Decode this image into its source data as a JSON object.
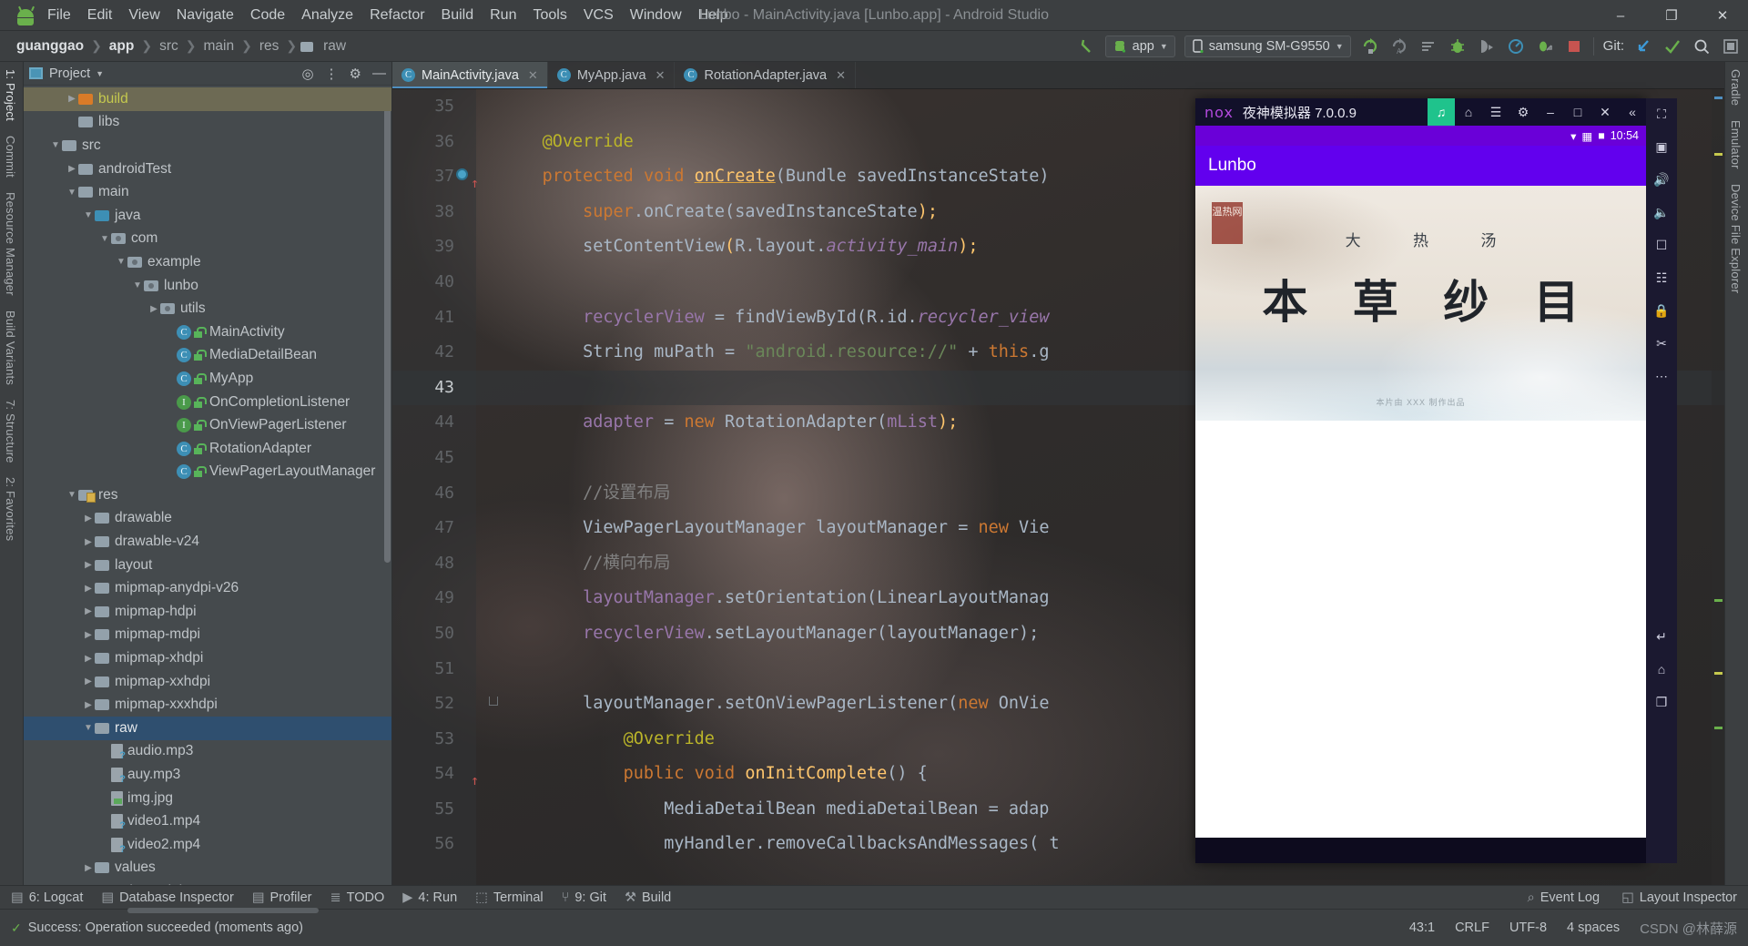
{
  "window": {
    "title": "Lunbo - MainActivity.java [Lunbo.app] - Android Studio",
    "minimize": "–",
    "maximize": "❐",
    "close": "✕"
  },
  "menu": [
    "File",
    "Edit",
    "View",
    "Navigate",
    "Code",
    "Analyze",
    "Refactor",
    "Build",
    "Run",
    "Tools",
    "VCS",
    "Window",
    "Help"
  ],
  "breadcrumb": [
    "guanggao",
    "app",
    "src",
    "main",
    "res",
    "raw"
  ],
  "toolbar": {
    "module_label": "app",
    "device_label": "samsung SM-G9550",
    "git_label": "Git:",
    "icons": [
      "back-arrow-icon",
      "rerun-icon",
      "rerun-failed-icon",
      "run-with-coverage-icon",
      "debug-icon",
      "attach-debugger-icon",
      "profiler-icon",
      "apply-changes-icon",
      "stop-icon",
      "git-update-icon",
      "git-commit-icon",
      "search-everywhere-icon",
      "settings-icon"
    ]
  },
  "project_panel": {
    "title": "Project",
    "tools": [
      "locate-icon",
      "collapse-all-icon",
      "settings-icon",
      "hide-icon"
    ],
    "tree": [
      {
        "depth": 2,
        "arrow": "▶",
        "label": "build",
        "icon": "folder-orange",
        "state": "hover"
      },
      {
        "depth": 2,
        "arrow": "",
        "label": "libs",
        "icon": "folder"
      },
      {
        "depth": 1,
        "arrow": "▼",
        "label": "src",
        "icon": "folder"
      },
      {
        "depth": 2,
        "arrow": "▶",
        "label": "androidTest",
        "icon": "folder"
      },
      {
        "depth": 2,
        "arrow": "▼",
        "label": "main",
        "icon": "folder"
      },
      {
        "depth": 3,
        "arrow": "▼",
        "label": "java",
        "icon": "folder-blue"
      },
      {
        "depth": 4,
        "arrow": "▼",
        "label": "com",
        "icon": "package"
      },
      {
        "depth": 5,
        "arrow": "▼",
        "label": "example",
        "icon": "package"
      },
      {
        "depth": 6,
        "arrow": "▼",
        "label": "lunbo",
        "icon": "package"
      },
      {
        "depth": 7,
        "arrow": "▶",
        "label": "utils",
        "icon": "package"
      },
      {
        "depth": 8,
        "arrow": "",
        "label": "MainActivity",
        "icon": "class"
      },
      {
        "depth": 8,
        "arrow": "",
        "label": "MediaDetailBean",
        "icon": "class"
      },
      {
        "depth": 8,
        "arrow": "",
        "label": "MyApp",
        "icon": "class"
      },
      {
        "depth": 8,
        "arrow": "",
        "label": "OnCompletionListener",
        "icon": "interface"
      },
      {
        "depth": 8,
        "arrow": "",
        "label": "OnViewPagerListener",
        "icon": "interface"
      },
      {
        "depth": 8,
        "arrow": "",
        "label": "RotationAdapter",
        "icon": "class"
      },
      {
        "depth": 8,
        "arrow": "",
        "label": "ViewPagerLayoutManager",
        "icon": "class"
      },
      {
        "depth": 2,
        "arrow": "▼",
        "label": "res",
        "icon": "folder-res"
      },
      {
        "depth": 3,
        "arrow": "▶",
        "label": "drawable",
        "icon": "folder"
      },
      {
        "depth": 3,
        "arrow": "▶",
        "label": "drawable-v24",
        "icon": "folder"
      },
      {
        "depth": 3,
        "arrow": "▶",
        "label": "layout",
        "icon": "folder"
      },
      {
        "depth": 3,
        "arrow": "▶",
        "label": "mipmap-anydpi-v26",
        "icon": "folder"
      },
      {
        "depth": 3,
        "arrow": "▶",
        "label": "mipmap-hdpi",
        "icon": "folder"
      },
      {
        "depth": 3,
        "arrow": "▶",
        "label": "mipmap-mdpi",
        "icon": "folder"
      },
      {
        "depth": 3,
        "arrow": "▶",
        "label": "mipmap-xhdpi",
        "icon": "folder"
      },
      {
        "depth": 3,
        "arrow": "▶",
        "label": "mipmap-xxhdpi",
        "icon": "folder"
      },
      {
        "depth": 3,
        "arrow": "▶",
        "label": "mipmap-xxxhdpi",
        "icon": "folder"
      },
      {
        "depth": 3,
        "arrow": "▼",
        "label": "raw",
        "icon": "folder",
        "state": "selected"
      },
      {
        "depth": 4,
        "arrow": "",
        "label": "audio.mp3",
        "icon": "file-unknown"
      },
      {
        "depth": 4,
        "arrow": "",
        "label": "auy.mp3",
        "icon": "file-unknown"
      },
      {
        "depth": 4,
        "arrow": "",
        "label": "img.jpg",
        "icon": "file-image"
      },
      {
        "depth": 4,
        "arrow": "",
        "label": "video1.mp4",
        "icon": "file-unknown"
      },
      {
        "depth": 4,
        "arrow": "",
        "label": "video2.mp4",
        "icon": "file-unknown"
      },
      {
        "depth": 3,
        "arrow": "▶",
        "label": "values",
        "icon": "folder"
      },
      {
        "depth": 3,
        "arrow": "▶",
        "label": "values-night",
        "icon": "folder"
      }
    ]
  },
  "left_rail": [
    "1: Project",
    "Commit",
    "Resource Manager",
    "Build Variants",
    "7: Structure",
    "2: Favorites"
  ],
  "right_rail": [
    "Gradle",
    "Emulator",
    "Device File Explorer"
  ],
  "editor": {
    "tabs": [
      {
        "label": "MainActivity.java",
        "active": true
      },
      {
        "label": "MyApp.java",
        "active": false
      },
      {
        "label": "RotationAdapter.java",
        "active": false
      }
    ],
    "first_line": 35,
    "caret_line": 43,
    "lines": [
      {
        "n": 35,
        "text": ""
      },
      {
        "n": 36,
        "text": "    @Override",
        "tokens": [
          {
            "t": "    ",
            "c": "plain"
          },
          {
            "t": "@Override",
            "c": "anno"
          }
        ]
      },
      {
        "n": 37,
        "marks": "breakpoint-override",
        "tokens": [
          {
            "t": "    ",
            "c": "plain"
          },
          {
            "t": "protected",
            "c": "kw"
          },
          {
            "t": " ",
            "c": "plain"
          },
          {
            "t": "void",
            "c": "kw"
          },
          {
            "t": " ",
            "c": "plain"
          },
          {
            "t": "onCreate",
            "c": "fn-u"
          },
          {
            "t": "(Bundle savedInstanceState)",
            "c": "plain"
          }
        ]
      },
      {
        "n": 38,
        "tokens": [
          {
            "t": "        ",
            "c": "plain"
          },
          {
            "t": "super",
            "c": "kw"
          },
          {
            "t": ".onCreate(savedInstanceState",
            "c": "plain"
          },
          {
            "t": ")",
            "c": "fn"
          },
          {
            "t": ";",
            "c": "fn"
          }
        ]
      },
      {
        "n": 39,
        "tokens": [
          {
            "t": "        setContentView",
            "c": "plain"
          },
          {
            "t": "(",
            "c": "fn"
          },
          {
            "t": "R.layout.",
            "c": "plain"
          },
          {
            "t": "activity_main",
            "c": "fld-i"
          },
          {
            "t": ")",
            "c": "fn"
          },
          {
            "t": ";",
            "c": "fn"
          }
        ]
      },
      {
        "n": 40,
        "text": ""
      },
      {
        "n": 41,
        "tokens": [
          {
            "t": "        ",
            "c": "plain"
          },
          {
            "t": "recyclerView",
            "c": "fld"
          },
          {
            "t": " = findViewById(",
            "c": "plain"
          },
          {
            "t": "R.id.",
            "c": "plain"
          },
          {
            "t": "recycler_view",
            "c": "fld-i"
          }
        ]
      },
      {
        "n": 42,
        "tokens": [
          {
            "t": "        String muPath = ",
            "c": "plain"
          },
          {
            "t": "\"android.resource://\"",
            "c": "str"
          },
          {
            "t": " + ",
            "c": "plain"
          },
          {
            "t": "this",
            "c": "kw"
          },
          {
            "t": ".g",
            "c": "plain"
          }
        ]
      },
      {
        "n": 43,
        "text": "",
        "caret": true
      },
      {
        "n": 44,
        "tokens": [
          {
            "t": "        ",
            "c": "plain"
          },
          {
            "t": "adapter",
            "c": "fld"
          },
          {
            "t": " = ",
            "c": "plain"
          },
          {
            "t": "new",
            "c": "kw"
          },
          {
            "t": " RotationAdapter(",
            "c": "plain"
          },
          {
            "t": "mList",
            "c": "fld"
          },
          {
            "t": ");",
            "c": "fn"
          }
        ]
      },
      {
        "n": 45,
        "text": ""
      },
      {
        "n": 46,
        "tokens": [
          {
            "t": "        //设置布局",
            "c": "cmt"
          }
        ]
      },
      {
        "n": 47,
        "tokens": [
          {
            "t": "        ViewPagerLayoutManager layoutManager = ",
            "c": "plain"
          },
          {
            "t": "new",
            "c": "kw"
          },
          {
            "t": " Vie",
            "c": "plain"
          }
        ]
      },
      {
        "n": 48,
        "tokens": [
          {
            "t": "        //横向布局",
            "c": "cmt"
          }
        ]
      },
      {
        "n": 49,
        "tokens": [
          {
            "t": "        ",
            "c": "plain"
          },
          {
            "t": "layoutManager",
            "c": "fld"
          },
          {
            "t": ".setOrientation(LinearLayoutManag",
            "c": "plain"
          }
        ]
      },
      {
        "n": 50,
        "tokens": [
          {
            "t": "        ",
            "c": "plain"
          },
          {
            "t": "recyclerView",
            "c": "fld"
          },
          {
            "t": ".setLayoutManager(layoutManager);",
            "c": "plain"
          }
        ]
      },
      {
        "n": 51,
        "text": ""
      },
      {
        "n": 52,
        "marks": "fold",
        "tokens": [
          {
            "t": "        layoutManager.setOnViewPagerListener(",
            "c": "plain"
          },
          {
            "t": "new",
            "c": "kw"
          },
          {
            "t": " OnVie",
            "c": "plain"
          }
        ]
      },
      {
        "n": 53,
        "tokens": [
          {
            "t": "            ",
            "c": "plain"
          },
          {
            "t": "@Override",
            "c": "anno"
          }
        ]
      },
      {
        "n": 54,
        "marks": "override",
        "tokens": [
          {
            "t": "            ",
            "c": "plain"
          },
          {
            "t": "public",
            "c": "kw"
          },
          {
            "t": " ",
            "c": "plain"
          },
          {
            "t": "void",
            "c": "kw"
          },
          {
            "t": " ",
            "c": "plain"
          },
          {
            "t": "onInitComplete",
            "c": "fn"
          },
          {
            "t": "() {",
            "c": "plain"
          }
        ]
      },
      {
        "n": 55,
        "tokens": [
          {
            "t": "                MediaDetailBean mediaDetailBean = adap",
            "c": "plain"
          }
        ]
      },
      {
        "n": 56,
        "tokens": [
          {
            "t": "                myHandler",
            "c": "plain"
          },
          {
            "t": ".removeCallbacksAndMessages( t",
            "c": "plain"
          }
        ]
      }
    ]
  },
  "emulator": {
    "brand": "nox",
    "name": "夜神模拟器 7.0.0.9",
    "titlebar_buttons": [
      "volume-icon",
      "home-icon",
      "menu-icon",
      "settings-icon",
      "minimize-icon",
      "maximize-icon",
      "close-icon",
      "collapse-icon"
    ],
    "status_time": "10:54",
    "status_icons": [
      "wifi-icon",
      "signal-icon",
      "battery-icon"
    ],
    "app_title": "Lunbo",
    "banner": {
      "seal": "温热网",
      "subtitle": "大 热 汤",
      "title": "本 草 纱 目",
      "credit": "本片由 XXX 制作出品"
    },
    "side_icons": [
      "fullscreen-icon",
      "screenshot-icon",
      "volume-up-icon",
      "volume-down-icon",
      "record-icon",
      "apk-install-icon",
      "lock-icon",
      "scissors-icon",
      "more-icon",
      "back-icon",
      "home-icon",
      "recents-icon"
    ]
  },
  "bottom_bar": {
    "items": [
      {
        "label": "6: Logcat",
        "icon": "logcat-icon"
      },
      {
        "label": "Database Inspector",
        "icon": "database-icon"
      },
      {
        "label": "Profiler",
        "icon": "profiler-icon"
      },
      {
        "label": "TODO",
        "icon": "todo-icon"
      },
      {
        "label": "4: Run",
        "icon": "run-icon"
      },
      {
        "label": "Terminal",
        "icon": "terminal-icon"
      },
      {
        "label": "9: Git",
        "icon": "git-icon"
      },
      {
        "label": "Build",
        "icon": "build-icon"
      }
    ],
    "right": [
      {
        "label": "Event Log",
        "icon": "event-log-icon"
      },
      {
        "label": "Layout Inspector",
        "icon": "layout-inspector-icon"
      }
    ]
  },
  "status_bar": {
    "message": "Success: Operation succeeded (moments ago)",
    "caret_position": "43:1",
    "line_separator": "CRLF",
    "encoding": "UTF-8",
    "indent": "4 spaces",
    "watermark": "CSDN @林薛源"
  },
  "colors": {
    "accent_blue": "#4f8fc0",
    "selection_blue": "#2f4f6f",
    "green": "#6ab04c",
    "purple": "#6200ee",
    "editor_bg": "#2b2b2b",
    "panel_bg": "#3c3f41"
  }
}
